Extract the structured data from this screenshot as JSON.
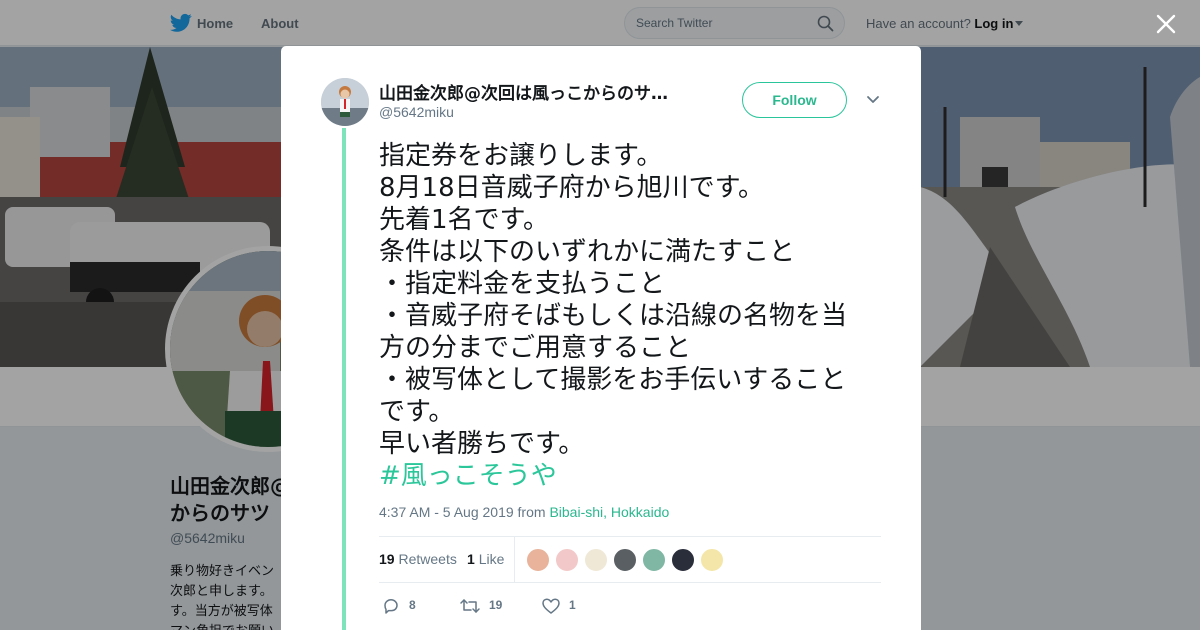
{
  "nav": {
    "home": "Home",
    "about": "About",
    "search_placeholder": "Search Twitter",
    "have_account": "Have an account?",
    "login": "Log in"
  },
  "profile_bg": {
    "name": "山田金次郎@次回は風っこからのサツ",
    "name_line1": "山田金次郎@",
    "name_line2": "からのサツ",
    "handle": "@5642miku",
    "bio_lines": [
      "乗り物好きイベン",
      "次郎と申します。",
      "す。当方が被写体",
      "マン角担でお願い"
    ]
  },
  "tweet": {
    "author_name": "山田金次郎@次回は風っこからのサ…",
    "author_handle": "@5642miku",
    "follow_label": "Follow",
    "lines": [
      "指定券をお譲りします。",
      "8月18日音威子府から旭川です。",
      "先着1名です。",
      "条件は以下のいずれかに満たすこと",
      "・指定料金を支払うこと",
      "・音威子府そばもしくは沿線の名物を当",
      "方の分までご用意すること",
      "・被写体として撮影をお手伝いすること",
      "です。",
      "早い者勝ちです。"
    ],
    "hashtag": "#風っこそうや",
    "timestamp": "4:37 AM - 5 Aug 2019 from",
    "location": "Bibai-shi, Hokkaido",
    "retweets_count": "19",
    "retweets_label": "Retweets",
    "likes_count": "1",
    "likes_label": "Like",
    "action_replies": "8",
    "action_retweets": "19",
    "action_likes": "1"
  },
  "colors": {
    "accent": "#2bc79a",
    "text": "#14171a",
    "muted": "#657786"
  }
}
